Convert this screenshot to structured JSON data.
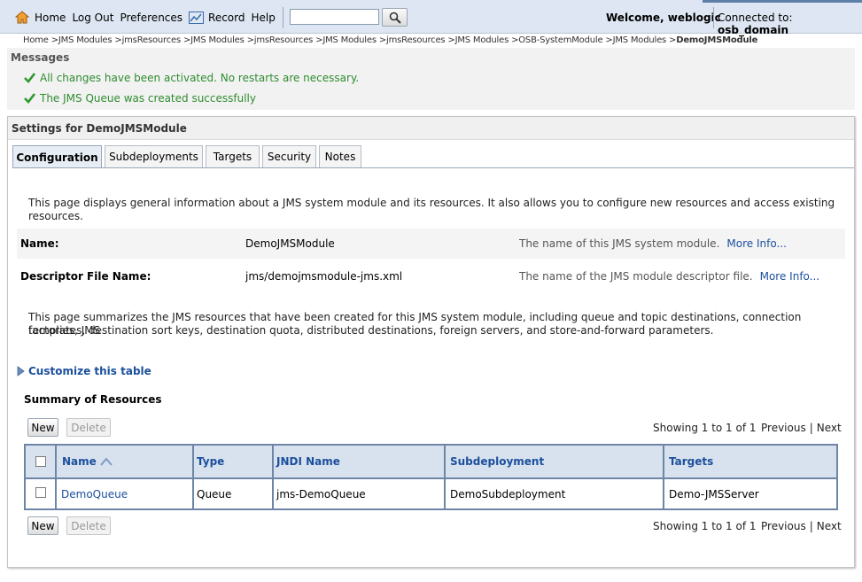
{
  "topbar": {
    "nav": [
      "Home",
      "Log Out",
      "Preferences",
      "Record",
      "Help"
    ],
    "search_value": "",
    "welcome": "Welcome, weblogic",
    "connected_label": "Connected to:",
    "connected_domain": "osb_domain"
  },
  "breadcrumb": {
    "items": [
      "Home",
      "JMS Modules",
      "jmsResources",
      "JMS Modules",
      "jmsResources",
      "JMS Modules",
      "jmsResources",
      "JMS Modules",
      "OSB-SystemModule",
      "JMS Modules"
    ],
    "current": "DemoJMSModule"
  },
  "messages": {
    "title": "Messages",
    "items": [
      "All changes have been activated. No restarts are necessary.",
      "The JMS Queue was created successfully"
    ],
    "color": "#2f8c2f"
  },
  "settings": {
    "title": "Settings for DemoJMSModule",
    "tabs": [
      "Configuration",
      "Subdeployments",
      "Targets",
      "Security",
      "Notes"
    ],
    "intro": "This page displays general information about a JMS system module and its resources. It also allows you to configure new resources and access existing resources.",
    "fields": [
      {
        "label": "Name:",
        "value": "DemoJMSModule",
        "desc": "The name of this JMS system module.",
        "more": "More Info..."
      },
      {
        "label": "Descriptor File Name:",
        "value": "jms/demojmsmodule-jms.xml",
        "desc": "The name of the JMS module descriptor file.",
        "more": "More Info..."
      }
    ],
    "summary_line1": "This page summarizes the JMS resources that have been created for this JMS system module, including queue and topic destinations, connection factories, JMS",
    "summary_line2": "templates, destination sort keys, destination quota, distributed destinations, foreign servers, and store-and-forward parameters.",
    "customize": "Customize this table"
  },
  "resources": {
    "title": "Summary of Resources",
    "new_label": "New",
    "delete_label": "Delete",
    "showing": "Showing 1 to 1 of 1",
    "previous": "Previous",
    "next": "Next",
    "columns": [
      "Name",
      "Type",
      "JNDI Name",
      "Subdeployment",
      "Targets"
    ],
    "rows": [
      [
        "DemoQueue",
        "Queue",
        "jms-DemoQueue",
        "DemoSubdeployment",
        "Demo-JMSServer"
      ]
    ]
  }
}
